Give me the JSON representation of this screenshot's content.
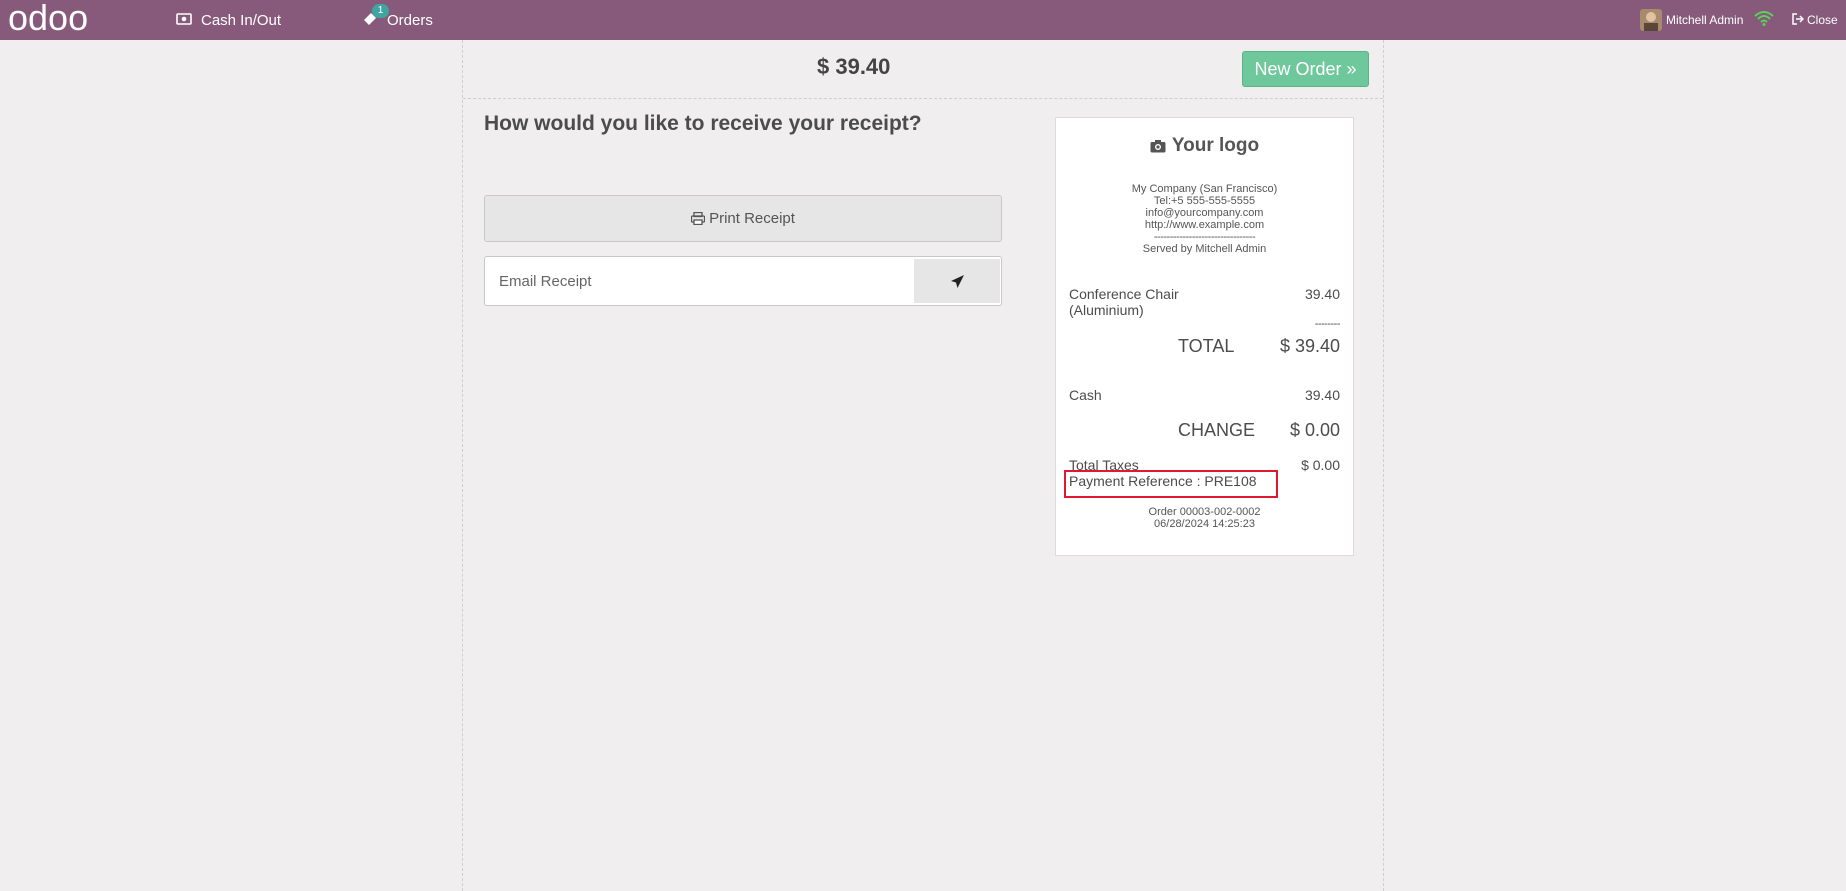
{
  "topbar": {
    "brand": "odoo",
    "cash_label": "Cash In/Out",
    "orders_label": "Orders",
    "orders_badge": "1",
    "user_name": "Mitchell Admin",
    "close_label": "Close",
    "bar_color": "#875a7b"
  },
  "main": {
    "total": "$ 39.40",
    "new_order_label": "New Order »",
    "question": "How would you like to receive your receipt?",
    "print_label": "Print Receipt",
    "email_placeholder": "Email Receipt"
  },
  "receipt": {
    "logo_text": "Your logo",
    "company": "My Company (San Francisco)",
    "tel": "Tel:+5 555-555-5555",
    "email": "info@yourcompany.com",
    "website": "http://www.example.com",
    "separator": "--------------------------------",
    "served_by": "Served by Mitchell Admin",
    "line_product": "Conference Chair (Aluminium)",
    "line_price": "39.40",
    "line_separator": "--------",
    "total_label": "TOTAL",
    "total_value": "$ 39.40",
    "payment_method": "Cash",
    "payment_amount": "39.40",
    "change_label": "CHANGE",
    "change_value": "$ 0.00",
    "taxes_label": "Total Taxes",
    "taxes_value": "$ 0.00",
    "payment_reference": "Payment Reference : PRE108",
    "order_number": "Order 00003-002-0002",
    "order_date": "06/28/2024 14:25:23"
  },
  "colors": {
    "new_order_green": "#6ec89b",
    "highlight_red": "#e0192f",
    "badge_teal": "#3fa5a0",
    "wifi_green": "#5bd15b"
  },
  "icons": {
    "cash": "money-icon",
    "orders": "ticket-icon",
    "wifi": "wifi-icon",
    "close": "sign-out-icon",
    "print": "print-icon",
    "send": "paper-plane-icon",
    "logo": "camera-icon"
  }
}
